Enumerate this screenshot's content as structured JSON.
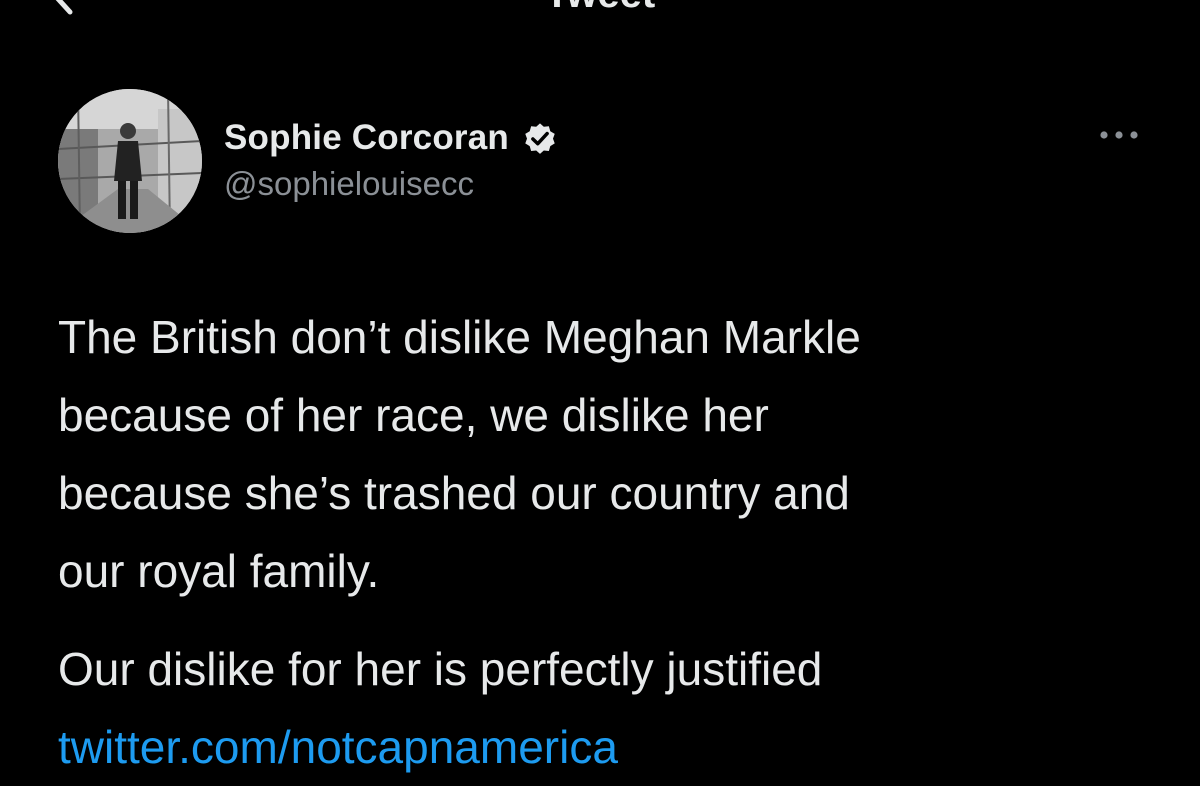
{
  "header": {
    "title": "Tweet",
    "back_icon": "chevron-left-icon"
  },
  "author": {
    "name": "Sophie Corcoran",
    "handle": "@sophielouisecc",
    "verified_icon": "verified-badge-icon",
    "more_icon": "more-dots-icon"
  },
  "tweet": {
    "text_lines": "The British don’t dislike Meghan Markle\nbecause of her race, we dislike her\nbecause she’s trashed our country and\nour royal family.",
    "text_2": "Our dislike for her is perfectly justified",
    "link": "twitter.com/notcapnamerica"
  },
  "colors": {
    "background": "#000000",
    "text": "#e7e9ea",
    "secondary": "#8b9096",
    "link": "#1d9bf0"
  }
}
